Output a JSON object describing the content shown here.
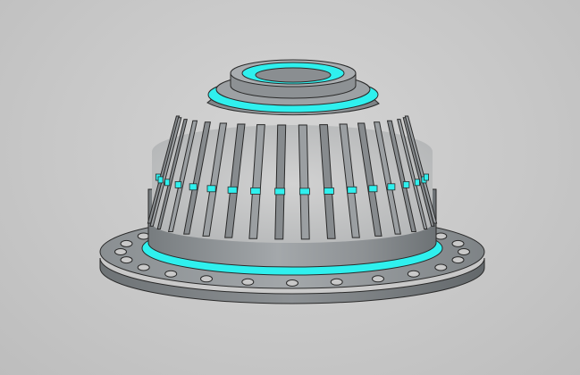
{
  "viewport": {
    "background_color": "#c8c8c8"
  },
  "model": {
    "name": "flanged-strainer-dome",
    "flange_hole_count": 24,
    "slot_count_visible": 16,
    "colors": {
      "body": "#8f9497",
      "body_light": "#b9bdc0",
      "body_dark": "#5f6467",
      "edge": "#2a2a2a",
      "highlight": "#2ff0ee",
      "interior": "#c9c9c9"
    }
  }
}
